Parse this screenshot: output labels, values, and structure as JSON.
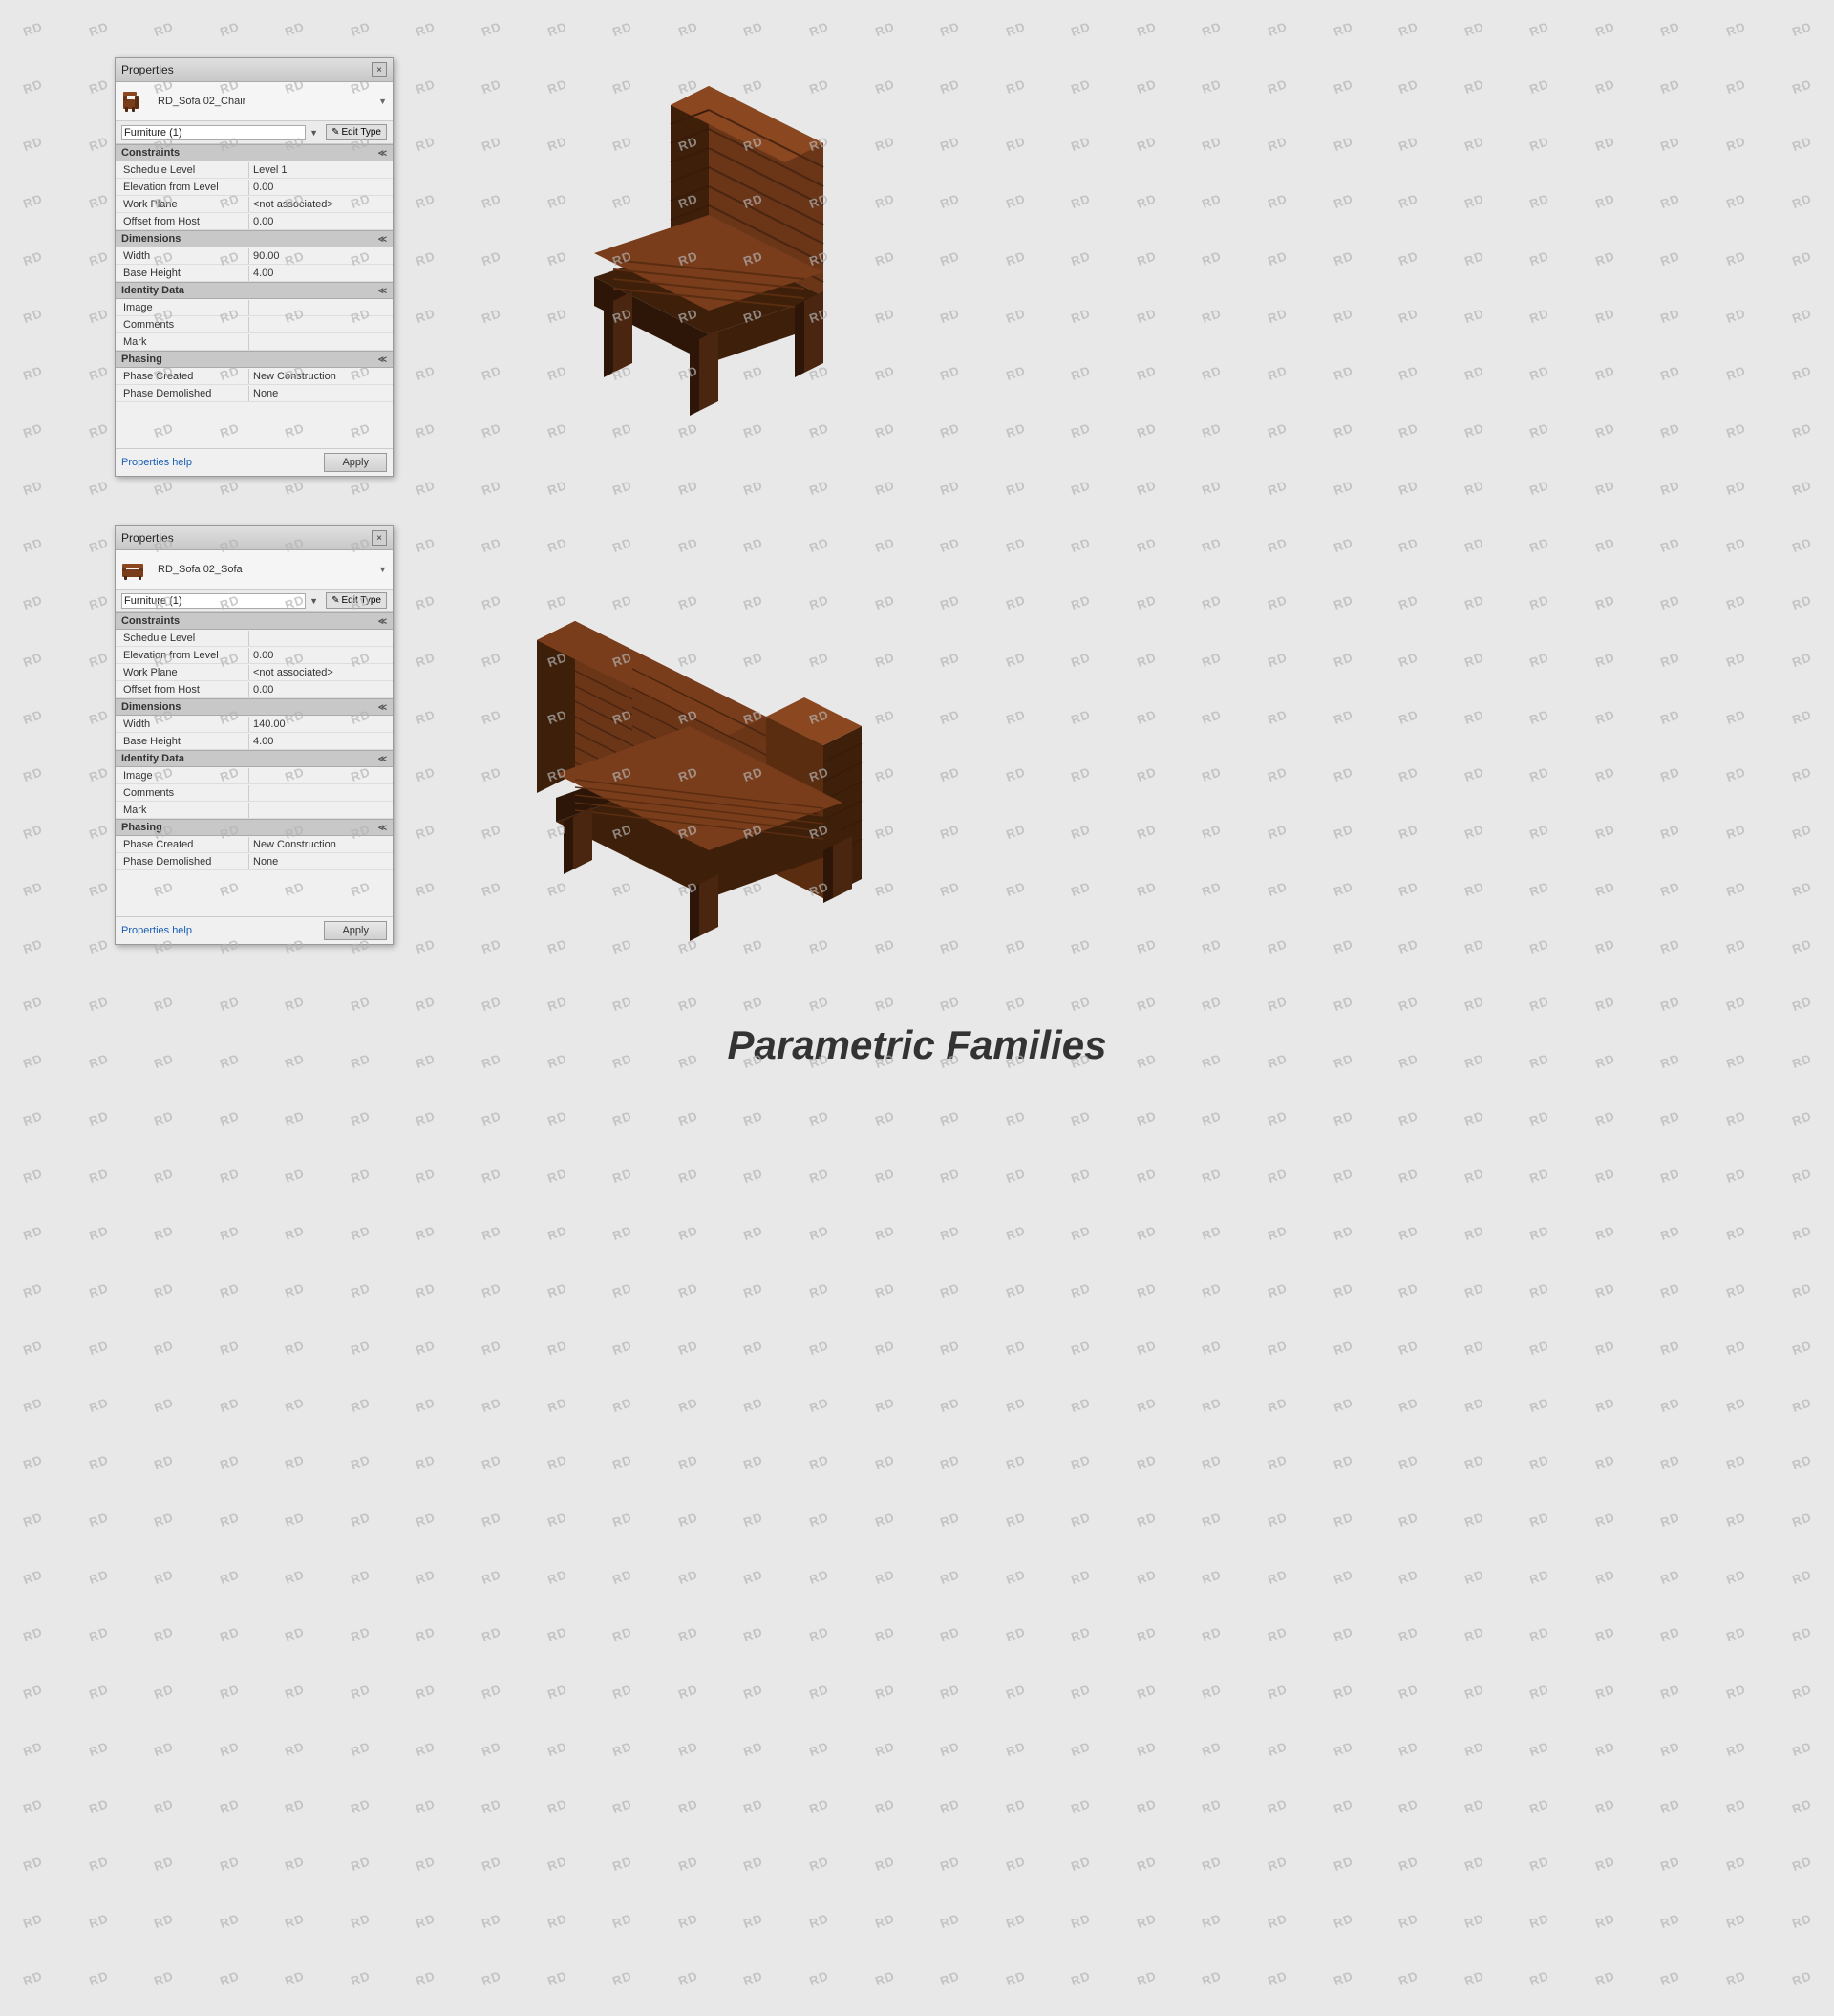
{
  "watermark": {
    "text": "RD",
    "rows": 35,
    "cols": 28
  },
  "page_title": "Parametric Families",
  "panel1": {
    "title": "Properties",
    "close_label": "×",
    "item_name": "RD_Sofa 02_Chair",
    "type_label": "Furniture (1)",
    "edit_type_label": "Edit Type",
    "sections": {
      "constraints": {
        "header": "Constraints",
        "toggle": "≪",
        "rows": [
          {
            "label": "Schedule Level",
            "value": "Level 1"
          },
          {
            "label": "Elevation from Level",
            "value": "0.00"
          },
          {
            "label": "Work Plane",
            "value": "<not associated>"
          },
          {
            "label": "Offset from Host",
            "value": "0.00"
          }
        ]
      },
      "dimensions": {
        "header": "Dimensions",
        "toggle": "≪",
        "rows": [
          {
            "label": "Width",
            "value": "90.00"
          },
          {
            "label": "Base Height",
            "value": "4.00"
          }
        ]
      },
      "identity_data": {
        "header": "Identity Data",
        "toggle": "≪",
        "rows": [
          {
            "label": "Image",
            "value": ""
          },
          {
            "label": "Comments",
            "value": ""
          },
          {
            "label": "Mark",
            "value": ""
          }
        ]
      },
      "phasing": {
        "header": "Phasing",
        "toggle": "≪",
        "rows": [
          {
            "label": "Phase Created",
            "value": "New Construction"
          },
          {
            "label": "Phase Demolished",
            "value": "None"
          }
        ]
      }
    },
    "properties_help": "Properties help",
    "apply_label": "Apply"
  },
  "panel2": {
    "title": "Properties",
    "close_label": "×",
    "item_name": "RD_Sofa 02_Sofa",
    "type_label": "Furniture (1)",
    "edit_type_label": "Edit Type",
    "sections": {
      "constraints": {
        "header": "Constraints",
        "toggle": "≪",
        "rows": [
          {
            "label": "Schedule Level",
            "value": ""
          },
          {
            "label": "Elevation from Level",
            "value": "0.00"
          },
          {
            "label": "Work Plane",
            "value": "<not associated>"
          },
          {
            "label": "Offset from Host",
            "value": "0.00"
          }
        ]
      },
      "dimensions": {
        "header": "Dimensions",
        "toggle": "≪",
        "rows": [
          {
            "label": "Width",
            "value": "140.00"
          },
          {
            "label": "Base Height",
            "value": "4.00"
          }
        ]
      },
      "identity_data": {
        "header": "Identity Data",
        "toggle": "≪",
        "rows": [
          {
            "label": "Image",
            "value": ""
          },
          {
            "label": "Comments",
            "value": ""
          },
          {
            "label": "Mark",
            "value": ""
          }
        ]
      },
      "phasing": {
        "header": "Phasing",
        "toggle": "≪",
        "rows": [
          {
            "label": "Phase Created",
            "value": "New Construction"
          },
          {
            "label": "Phase Demolished",
            "value": "None"
          }
        ]
      }
    },
    "properties_help": "Properties help",
    "apply_label": "Apply"
  },
  "colors": {
    "sofa_dark": "#4a2510",
    "sofa_mid": "#6b3518",
    "sofa_light": "#7a3d1c",
    "sofa_highlight": "#8b4820"
  }
}
